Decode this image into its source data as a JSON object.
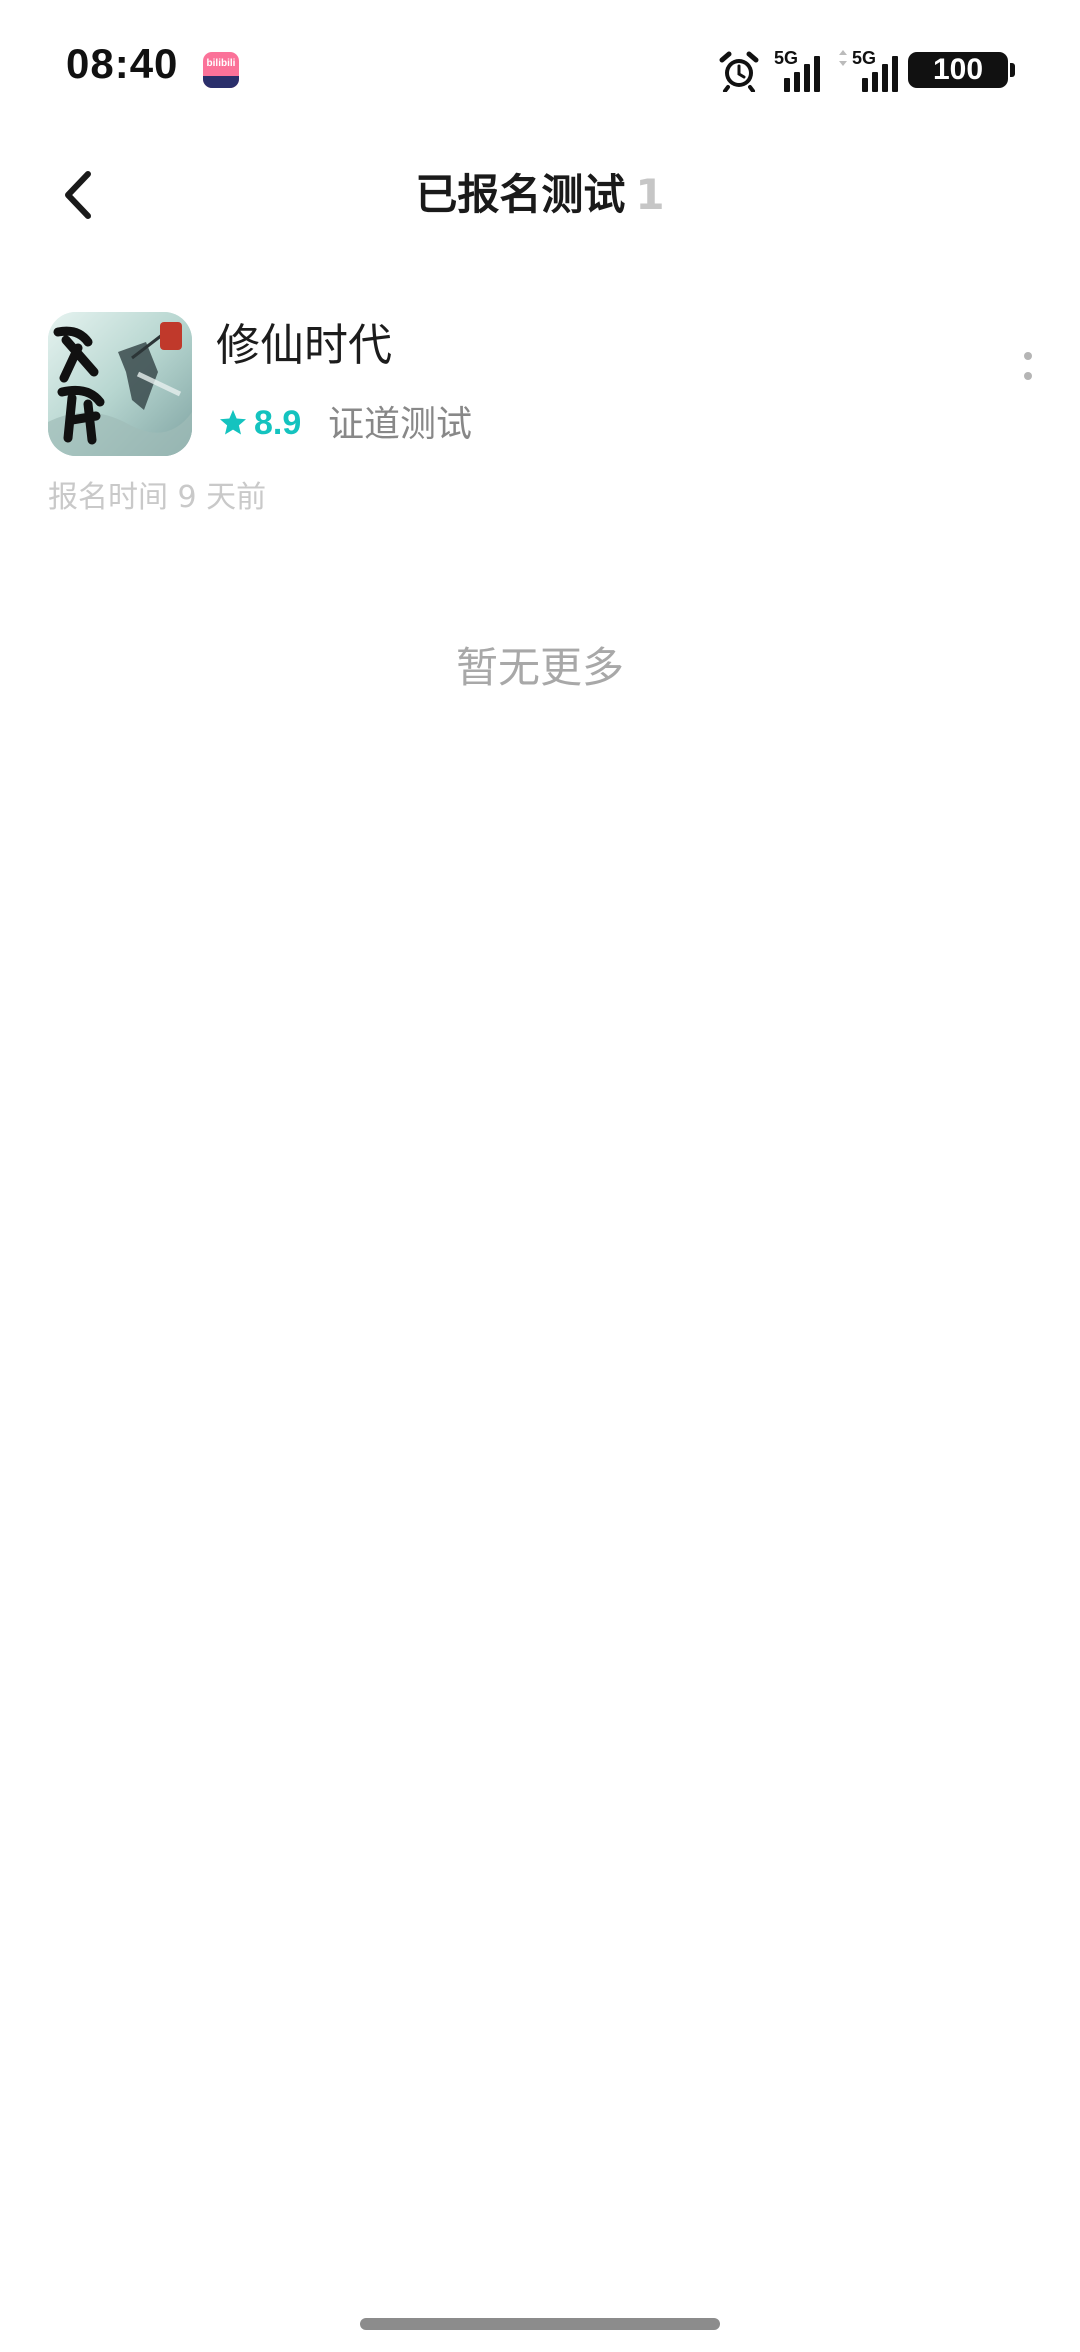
{
  "status_bar": {
    "time": "08:40",
    "app_badge_top": "bilibili",
    "app_badge_bottom": "",
    "network_1": "5G",
    "network_2": "5G",
    "battery": "100"
  },
  "header": {
    "title": "已报名测试",
    "count": "1"
  },
  "games": [
    {
      "name": "修仙时代",
      "icon_text": "修仙",
      "rating": "8.9",
      "test_type": "证道测试",
      "signup_time": "报名时间 9 天前"
    }
  ],
  "footer": {
    "no_more": "暂无更多"
  },
  "colors": {
    "accent": "#14c3bf",
    "title": "#1a1a1a",
    "muted": "#a8a8a8"
  },
  "icons": {
    "back": "chevron-left-icon",
    "more": "more-vertical-icon",
    "star": "star-icon",
    "alarm": "alarm-clock-icon"
  }
}
